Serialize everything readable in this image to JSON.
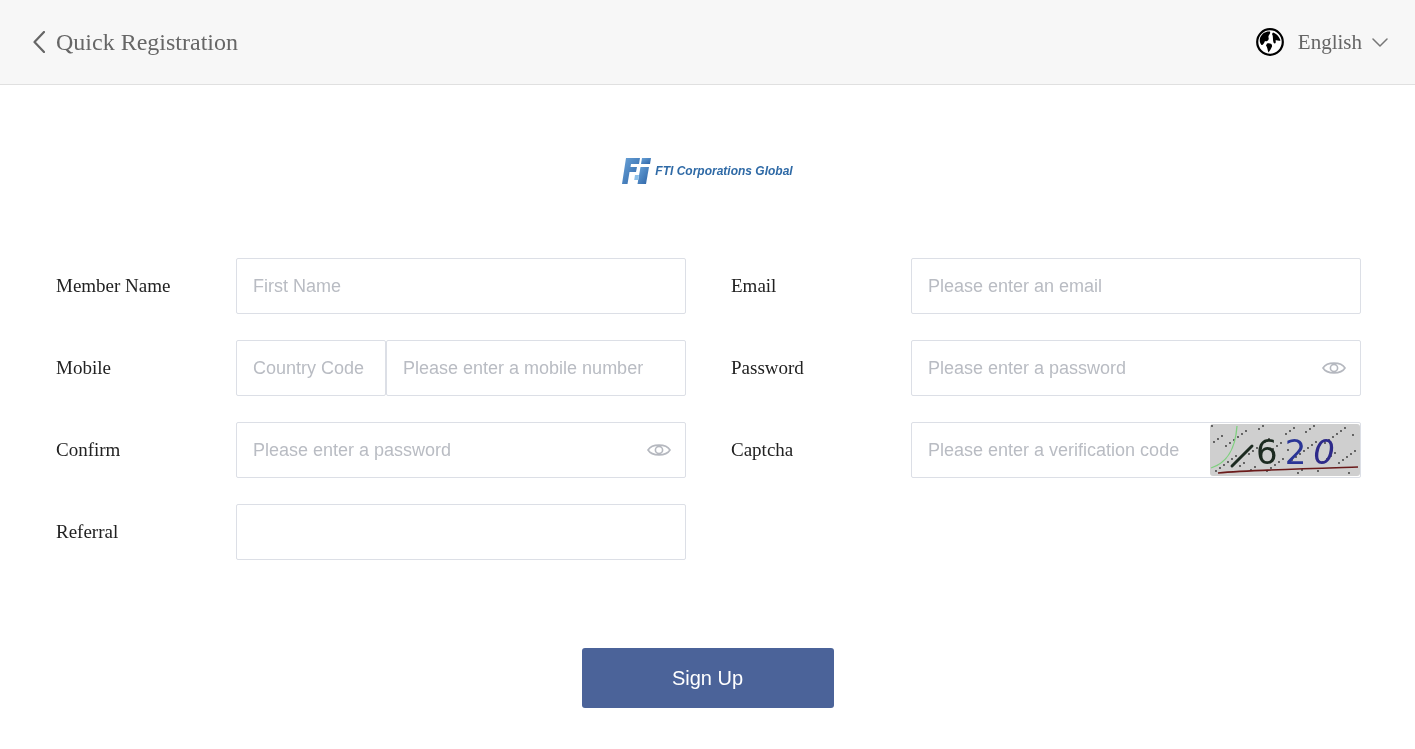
{
  "header": {
    "title": "Quick Registration",
    "language": "English"
  },
  "logo": {
    "text": "FTI Corporations Global"
  },
  "fields": [
    {
      "label": "Member Name",
      "kind": "text",
      "placeholder": "First Name"
    },
    {
      "label": "Email",
      "kind": "text",
      "placeholder": "Please enter an email"
    },
    {
      "label": "Mobile",
      "kind": "phone",
      "code_placeholder": "Country Code",
      "placeholder": "Please enter a mobile number"
    },
    {
      "label": "Password",
      "kind": "password",
      "placeholder": "Please enter a password"
    },
    {
      "label": "Confirm",
      "kind": "password",
      "placeholder": "Please enter a password"
    },
    {
      "label": "Captcha",
      "kind": "captcha",
      "placeholder": "Please enter a verification code",
      "captcha_code": "620"
    },
    {
      "label": "Referral",
      "kind": "text"
    }
  ],
  "submit": "Sign Up"
}
